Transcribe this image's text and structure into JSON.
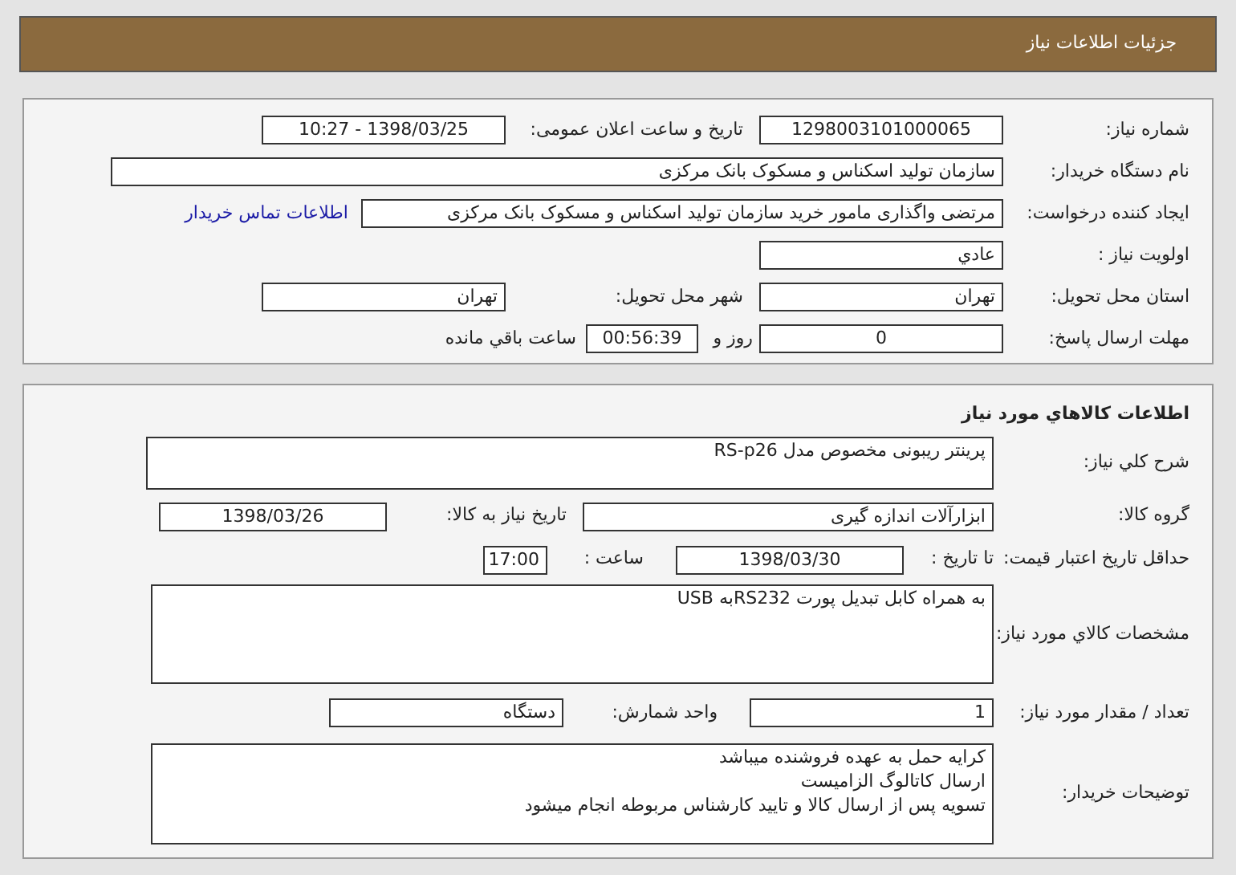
{
  "header": {
    "title": "جزئیات اطلاعات نیاز"
  },
  "summary": {
    "need_number": {
      "label": "شماره نیاز:",
      "value": "1298003101000065"
    },
    "announce_datetime": {
      "label": "تاریخ و ساعت اعلان عمومی:",
      "value": "1398/03/25 - 10:27"
    },
    "buyer_org": {
      "label": "نام دستگاه خریدار:",
      "value": "سازمان تولید اسکناس و مسکوک بانک مرکزی"
    },
    "requester": {
      "label": "ایجاد کننده درخواست:",
      "value": "مرتضی واگذاری مامور خرید سازمان تولید اسکناس و مسکوک بانک مرکزی"
    },
    "contact_link": "اطلاعات تماس خریدار",
    "priority": {
      "label": "اولویت نیاز :",
      "value": "عادي"
    },
    "province": {
      "label": "استان محل تحویل:",
      "value": "تهران"
    },
    "city": {
      "label": "شهر محل تحویل:",
      "value": "تهران"
    },
    "deadline": {
      "label": "مهلت ارسال پاسخ:",
      "days": "0",
      "days_label": "روز و",
      "time": "00:56:39",
      "time_label": "ساعت باقي مانده"
    }
  },
  "goods": {
    "title": "اطلاعات کالاهاي مورد نياز",
    "description": {
      "label": "شرح کلي نياز:",
      "value": "پرینتر ریبونی مخصوص  مدل RS-p26"
    },
    "group": {
      "label": "گروه کالا:",
      "value": "ابزارآلات اندازه گیری"
    },
    "need_date": {
      "label": "تاریخ نیاز به کالا:",
      "value": "1398/03/26"
    },
    "price_validity": {
      "label": "حداقل تاریخ اعتبار قیمت:",
      "to_label": "تا تاریخ :",
      "date": "1398/03/30",
      "time_label": "ساعت :",
      "time": "17:00"
    },
    "specs": {
      "label": "مشخصات کالاي مورد نياز:",
      "value": "به همراه کابل تبدیل پورت RS232به USB"
    },
    "quantity": {
      "label": "تعداد / مقدار مورد نیاز:",
      "value": "1"
    },
    "unit": {
      "label": "واحد شمارش:",
      "value": "دستگاه"
    },
    "notes": {
      "label": "توضیحات خریدار:",
      "lines": [
        "کرایه حمل به عهده فروشنده میباشد",
        "ارسال کاتالوگ الزامیست",
        "تسویه پس از ارسال کالا و تایید کارشناس مربوطه انجام میشود"
      ]
    }
  }
}
